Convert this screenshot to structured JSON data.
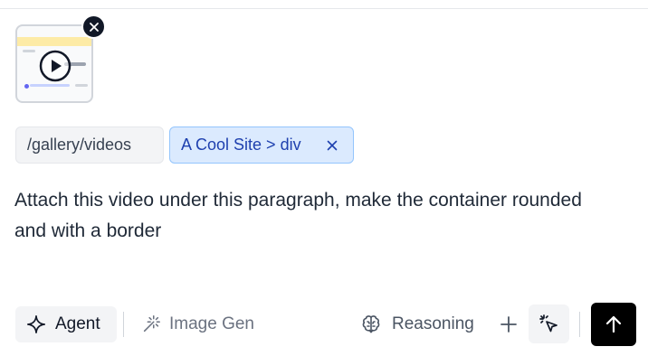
{
  "attachment": {
    "type": "video",
    "icons": {
      "play": "play-circle-icon",
      "remove": "close-icon"
    }
  },
  "context_chips": [
    {
      "label": "/gallery/videos"
    },
    {
      "label": "A Cool Site > div",
      "removable": true
    }
  ],
  "prompt": {
    "text": "Attach this video under this paragraph, make the container rounded and with a border"
  },
  "toolbar": {
    "agent_label": "Agent",
    "image_gen_label": "Image Gen",
    "reasoning_label": "Reasoning",
    "icons": {
      "agent": "sparkle-icon",
      "image_gen": "magic-wand-icon",
      "reasoning": "brain-icon",
      "add": "plus-icon",
      "select": "pointer-click-icon",
      "send": "arrow-up-icon"
    }
  },
  "colors": {
    "element_chip_bg": "#dbeafe",
    "element_chip_text": "#1e40af",
    "send_button_bg": "#000000",
    "remove_badge_bg": "#111827"
  }
}
